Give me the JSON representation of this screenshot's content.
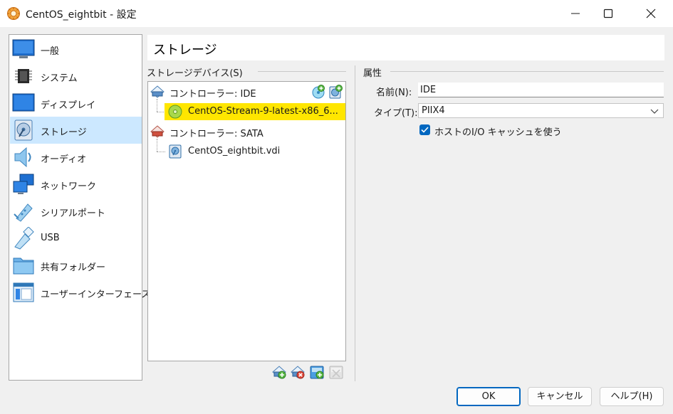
{
  "window": {
    "title": "CentOS_eightbit - 設定",
    "icons": {
      "app": "virtualbox-gear-icon",
      "minimize": "minimize-icon",
      "maximize": "maximize-icon",
      "close": "close-icon"
    }
  },
  "sidebar": {
    "items": [
      {
        "label": "一般",
        "icon": "monitor-icon"
      },
      {
        "label": "システム",
        "icon": "chip-icon"
      },
      {
        "label": "ディスプレイ",
        "icon": "display-icon"
      },
      {
        "label": "ストレージ",
        "icon": "storage-disk-icon",
        "selected": true
      },
      {
        "label": "オーディオ",
        "icon": "speaker-icon"
      },
      {
        "label": "ネットワーク",
        "icon": "network-icon"
      },
      {
        "label": "シリアルポート",
        "icon": "serial-port-icon"
      },
      {
        "label": "USB",
        "icon": "usb-icon"
      },
      {
        "label": "共有フォルダー",
        "icon": "folder-icon"
      },
      {
        "label": "ユーザーインターフェース",
        "icon": "window-ui-icon"
      }
    ]
  },
  "header": {
    "title": "ストレージ"
  },
  "storage": {
    "group_label": "ストレージデバイス(S)",
    "tree": [
      {
        "label": "コントローラー: IDE",
        "type": "controller"
      },
      {
        "label": "CentOS-Stream-9-latest-x86_6...",
        "type": "optical",
        "selected": true
      },
      {
        "label": "コントローラー: SATA",
        "type": "controller"
      },
      {
        "label": "CentOS_eightbit.vdi",
        "type": "hard-disk"
      }
    ]
  },
  "attributes": {
    "group_label": "属性",
    "name_label": "名前(N):",
    "name_value": "IDE",
    "type_label": "タイプ(T):",
    "type_value": "PIIX4",
    "cache_label": "ホストのI/O キャッシュを使う",
    "cache_checked": true
  },
  "buttons": {
    "ok": "OK",
    "cancel": "キャンセル",
    "help": "ヘルプ(H)"
  },
  "colors": {
    "selection_sidebar": "#cce8ff",
    "selection_tree": "#ffe600",
    "accent": "#0067c0"
  }
}
